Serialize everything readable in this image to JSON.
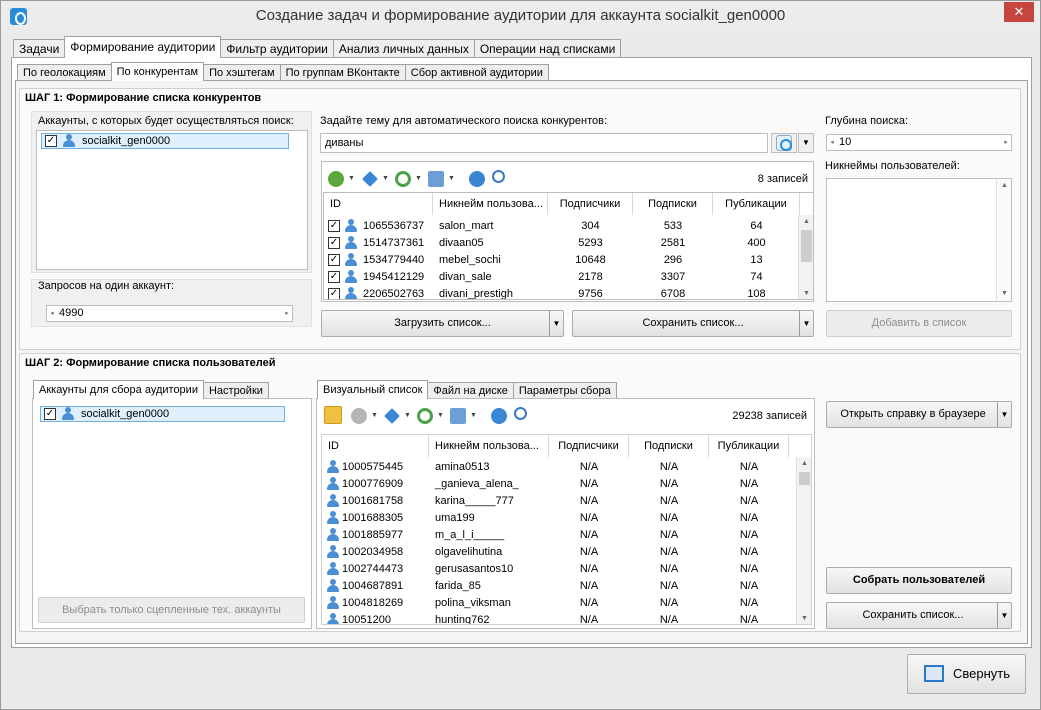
{
  "window": {
    "title": "Создание задач и формирование аудитории для аккаунта socialkit_gen0000",
    "close_glyph": "✕"
  },
  "main_tabs": [
    "Задачи",
    "Формирование аудитории",
    "Фильтр аудитории",
    "Анализ личных данных",
    "Операции над списками"
  ],
  "sub_tabs": [
    "По геолокациям",
    "По конкурентам",
    "По хэштегам",
    "По группам ВКонтакте",
    "Сбор активной аудитории"
  ],
  "step1": {
    "title": "ШАГ 1: Формирование списка конкурентов",
    "accounts_label": "Аккаунты, с которых будет осуществляться поиск:",
    "accounts": [
      "socialkit_gen0000"
    ],
    "requests_label": "Запросов на один аккаунт:",
    "requests_value": "4990",
    "topic_label": "Задайте тему для автоматического поиска конкурентов:",
    "topic_value": "диваны",
    "records": "8 записей",
    "columns": [
      "ID",
      "Никнейм пользова...",
      "Подписчики",
      "Подписки",
      "Публикации"
    ],
    "rows": [
      [
        "1065536737",
        "salon_mart",
        "304",
        "533",
        "64"
      ],
      [
        "1514737361",
        "divaan05",
        "5293",
        "2581",
        "400"
      ],
      [
        "1534779440",
        "mebel_sochi",
        "10648",
        "296",
        "13"
      ],
      [
        "1945412129",
        "divan_sale",
        "2178",
        "3307",
        "74"
      ],
      [
        "2206502763",
        "divani_prestigh",
        "9756",
        "6708",
        "108"
      ]
    ],
    "load_btn": "Загрузить список...",
    "save_btn": "Сохранить список...",
    "depth_label": "Глубина поиска:",
    "depth_value": "10",
    "nicknames_label": "Никнеймы пользователей:",
    "add_btn": "Добавить в список"
  },
  "step2": {
    "title": "ШАГ 2: Формирование списка пользователей",
    "left_tabs": [
      "Аккаунты для сбора аудитории",
      "Настройки"
    ],
    "accounts": [
      "socialkit_gen0000"
    ],
    "select_linked_btn": "Выбрать только сцепленные тех. аккаунты",
    "mid_tabs": [
      "Визуальный список",
      "Файл на диске",
      "Параметры сбора"
    ],
    "records": "29238 записей",
    "columns": [
      "ID",
      "Никнейм пользова...",
      "Подписчики",
      "Подписки",
      "Публикации"
    ],
    "rows": [
      [
        "1000575445",
        "amina0513",
        "N/A",
        "N/A",
        "N/A"
      ],
      [
        "1000776909",
        "_ganieva_alena_",
        "N/A",
        "N/A",
        "N/A"
      ],
      [
        "1001681758",
        "karina_____777",
        "N/A",
        "N/A",
        "N/A"
      ],
      [
        "1001688305",
        "uma199",
        "N/A",
        "N/A",
        "N/A"
      ],
      [
        "1001885977",
        "m_a_l_i_____",
        "N/A",
        "N/A",
        "N/A"
      ],
      [
        "1002034958",
        "olgavelihutina",
        "N/A",
        "N/A",
        "N/A"
      ],
      [
        "1002744473",
        "gerusasantos10",
        "N/A",
        "N/A",
        "N/A"
      ],
      [
        "1004687891",
        "farida_85",
        "N/A",
        "N/A",
        "N/A"
      ],
      [
        "1004818269",
        "polina_viksman",
        "N/A",
        "N/A",
        "N/A"
      ],
      [
        "10051200",
        "hunting762",
        "N/A",
        "N/A",
        "N/A"
      ]
    ],
    "help_btn": "Открыть справку в браузере",
    "collect_btn": "Собрать пользователей",
    "save_btn": "Сохранить список..."
  },
  "collapse_btn": "Свернуть"
}
